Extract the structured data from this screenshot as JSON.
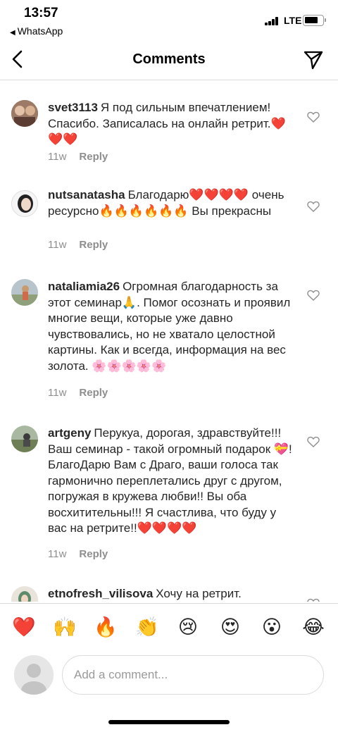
{
  "status_bar": {
    "time": "13:57",
    "back_app": "WhatsApp",
    "network": "LTE"
  },
  "header": {
    "title": "Comments"
  },
  "comments": [
    {
      "username": "svet3113",
      "text": "Я под сильным впечатлением! Спасибо. Записалась на онлайн ретрит.❤️❤️❤️",
      "time": "11w",
      "reply_label": "Reply"
    },
    {
      "username": "nutsanatasha",
      "text": "Благодарю❤️❤️❤️❤️ очень ресурсно🔥🔥🔥🔥🔥🔥 Вы прекрасны",
      "time": "11w",
      "reply_label": "Reply"
    },
    {
      "username": "nataliamia26",
      "text": "Огромная благодарность за этот семинар🙏. Помог осознать и проявил многие вещи, которые уже давно чувствовались, но не хватало целостной картины. Как и всегда, информация на вес золота. 🌸🌸🌸🌸🌸",
      "time": "11w",
      "reply_label": "Reply"
    },
    {
      "username": "artgeny",
      "text": "Перукуа, дорогая, здравствуйте!!! Ваш семинар - такой огромный подарок 💝! БлагоДарю Вам с Драго, ваши голоса так гармонично переплетались друг с другом, погружая в кружева любви!! Вы оба восхитительны!!! Я счастлива, что буду у вас на ретрите!!❤️❤️❤️❤️",
      "time": "11w",
      "reply_label": "Reply"
    },
    {
      "username": "etnofresh_vilisova",
      "text": "Хочу на ретрит.",
      "time": "",
      "reply_label": ""
    }
  ],
  "emoji_bar": [
    "❤️",
    "🙌",
    "🔥",
    "👏",
    "😢",
    "😍",
    "😮",
    "😂"
  ],
  "composer": {
    "placeholder": "Add a comment..."
  },
  "colors": {
    "secondary_text": "#8e8e8e",
    "divider": "#dbdbdb",
    "primary_text": "#262626"
  }
}
